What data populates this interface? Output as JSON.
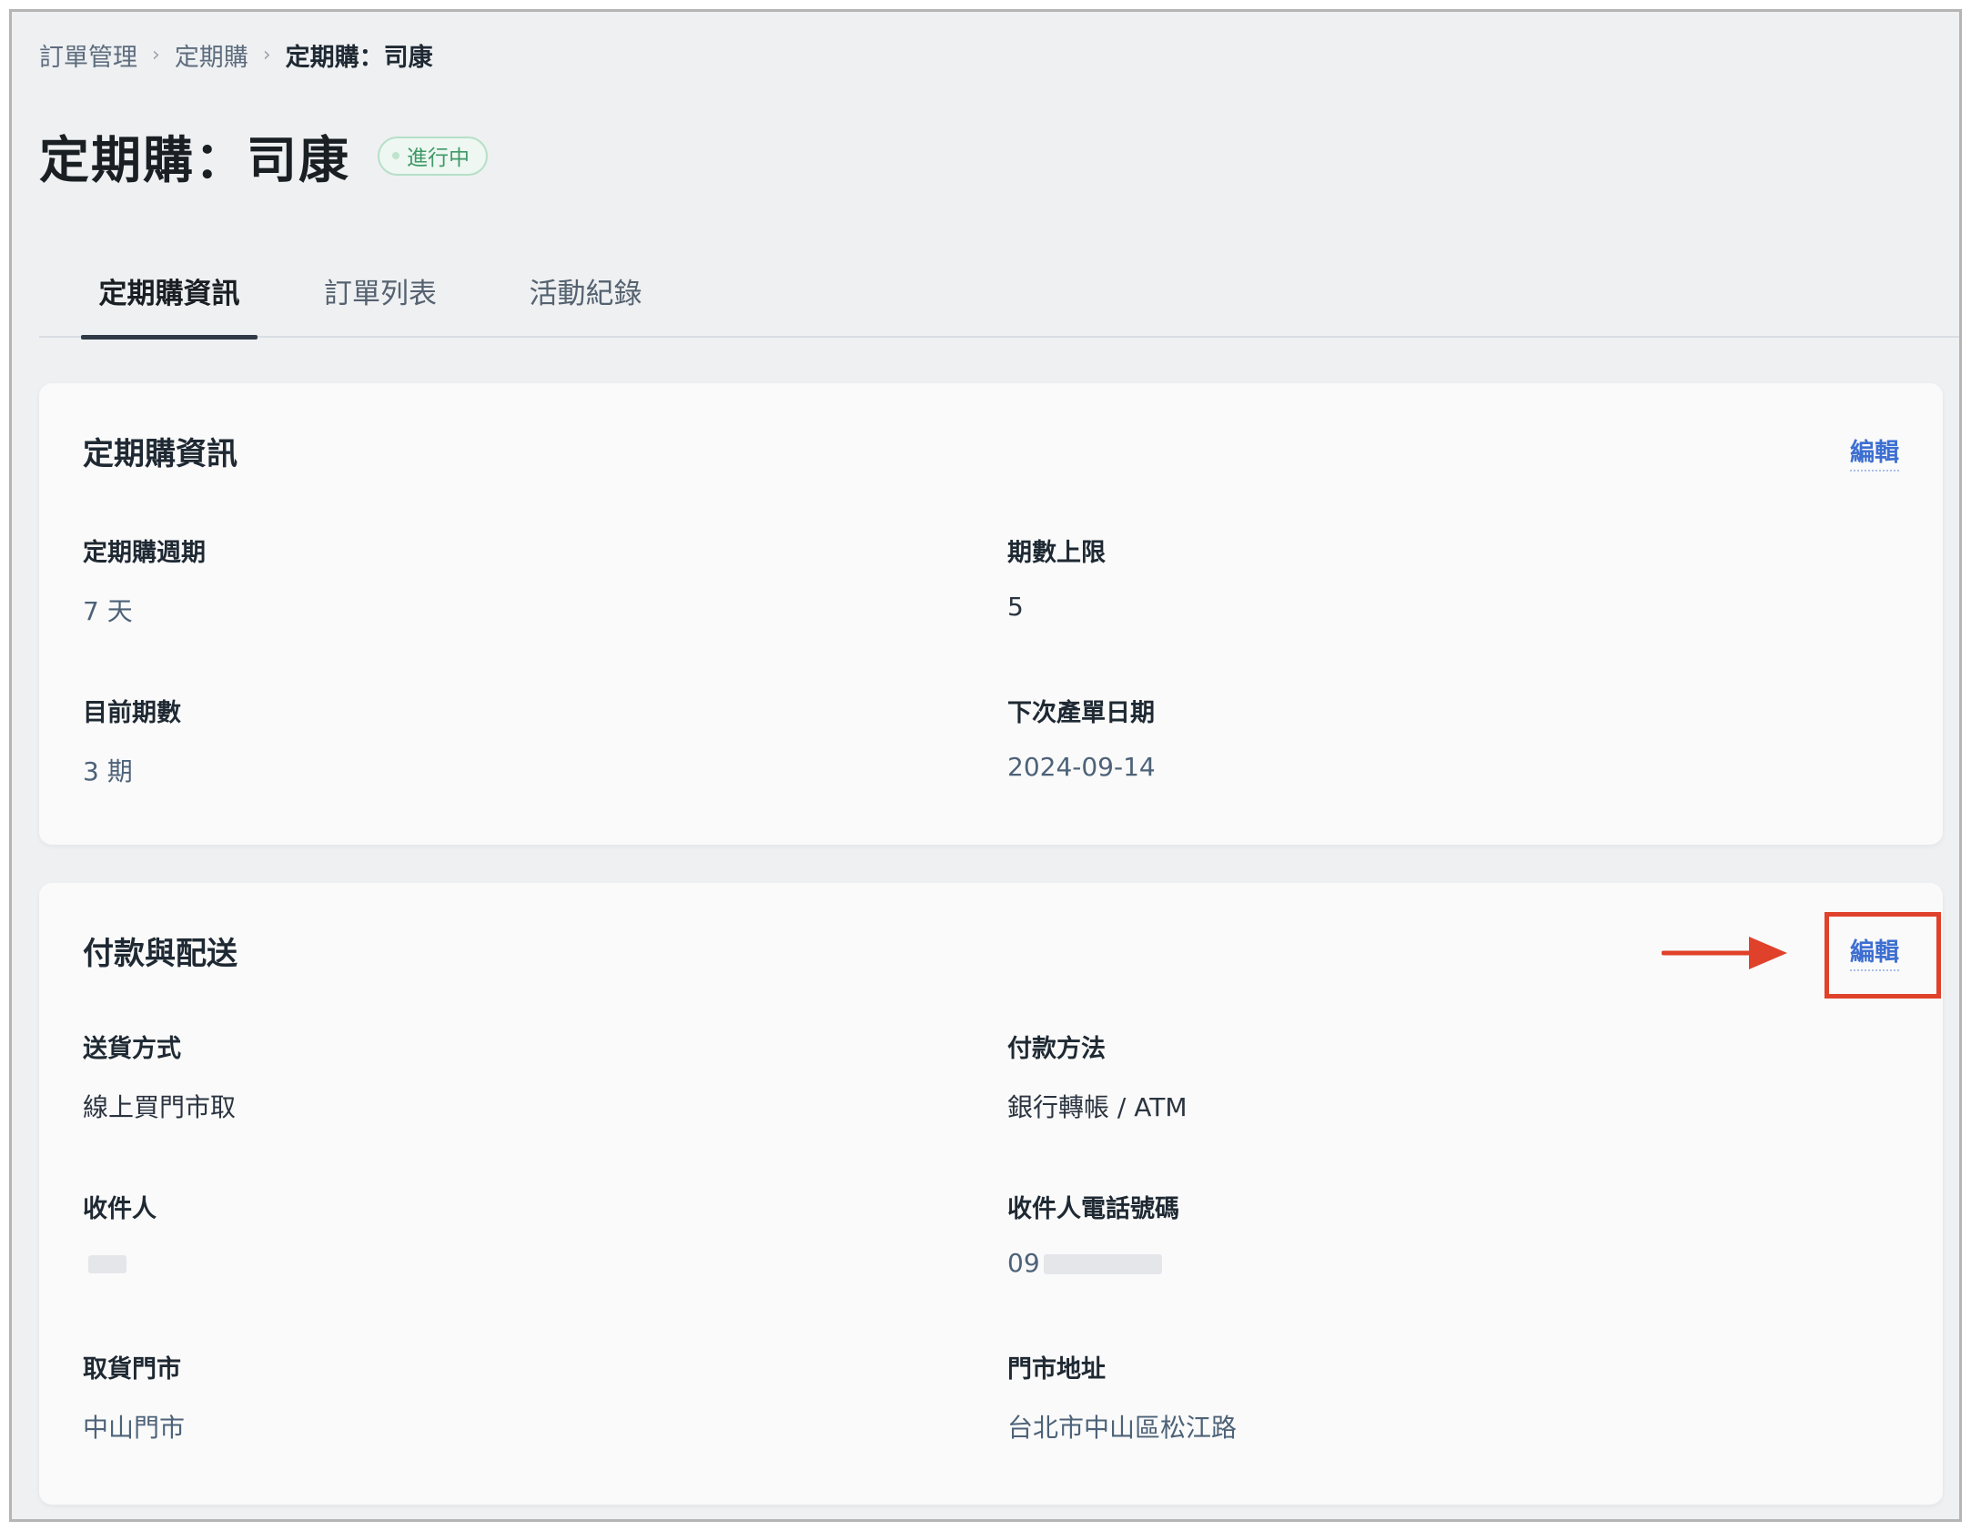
{
  "breadcrumb": {
    "items": [
      "訂單管理",
      "定期購",
      "定期購：司康"
    ]
  },
  "page": {
    "title": "定期購：司康",
    "status": "進行中"
  },
  "tabs": [
    {
      "label": "定期購資訊",
      "active": true
    },
    {
      "label": "訂單列表",
      "active": false
    },
    {
      "label": "活動紀錄",
      "active": false
    }
  ],
  "subscription_card": {
    "title": "定期購資訊",
    "edit_label": "編輯",
    "fields": [
      {
        "label": "定期購週期",
        "value": "7 天"
      },
      {
        "label": "期數上限",
        "value": "5"
      },
      {
        "label": "目前期數",
        "value": "3 期"
      },
      {
        "label": "下次產單日期",
        "value": "2024-09-14"
      }
    ]
  },
  "payment_card": {
    "title": "付款與配送",
    "edit_label": "編輯",
    "fields": [
      {
        "label": "送貨方式",
        "value": "線上買門市取"
      },
      {
        "label": "付款方法",
        "value": "銀行轉帳 / ATM"
      },
      {
        "label": "收件人",
        "value": ""
      },
      {
        "label": "收件人電話號碼",
        "value": "09"
      },
      {
        "label": "取貨門市",
        "value": "中山門市"
      },
      {
        "label": "門市地址",
        "value": "台北市中山區松江路"
      }
    ]
  },
  "colors": {
    "accent": "#3d6fd1",
    "status_green": "#3e9a68",
    "annotation_red": "#e0412b"
  }
}
